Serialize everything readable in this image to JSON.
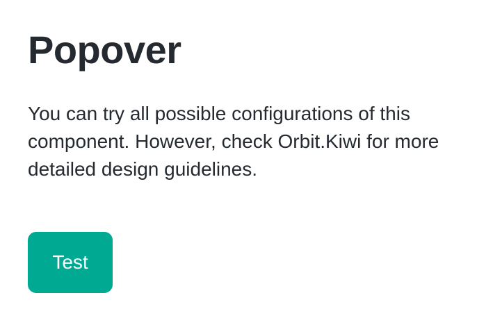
{
  "header": {
    "title": "Popover"
  },
  "main": {
    "description": "You can try all possible configurations of this component. However, check Orbit.Kiwi for more detailed design guidelines.",
    "button_label": "Test"
  },
  "colors": {
    "text": "#252a31",
    "button_background": "#00a991",
    "button_text": "#ffffff",
    "page_background": "#ffffff"
  }
}
